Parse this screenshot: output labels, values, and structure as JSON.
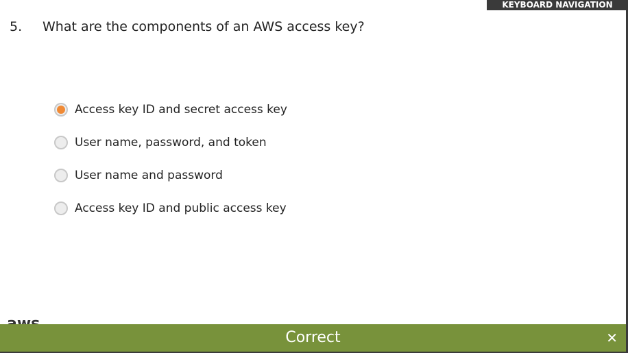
{
  "header": {
    "keyboard_nav": "KEYBOARD NAVIGATION"
  },
  "question": {
    "number": "5.",
    "text": "What are the components of an AWS access key?"
  },
  "options": [
    {
      "label": "Access key ID and secret access key",
      "selected": true
    },
    {
      "label": "User name, password, and token",
      "selected": false
    },
    {
      "label": "User name and password",
      "selected": false
    },
    {
      "label": "Access key ID and public access key",
      "selected": false
    }
  ],
  "logo": "aws",
  "feedback": {
    "text": "Correct",
    "close": "✕",
    "color": "#78923b"
  }
}
